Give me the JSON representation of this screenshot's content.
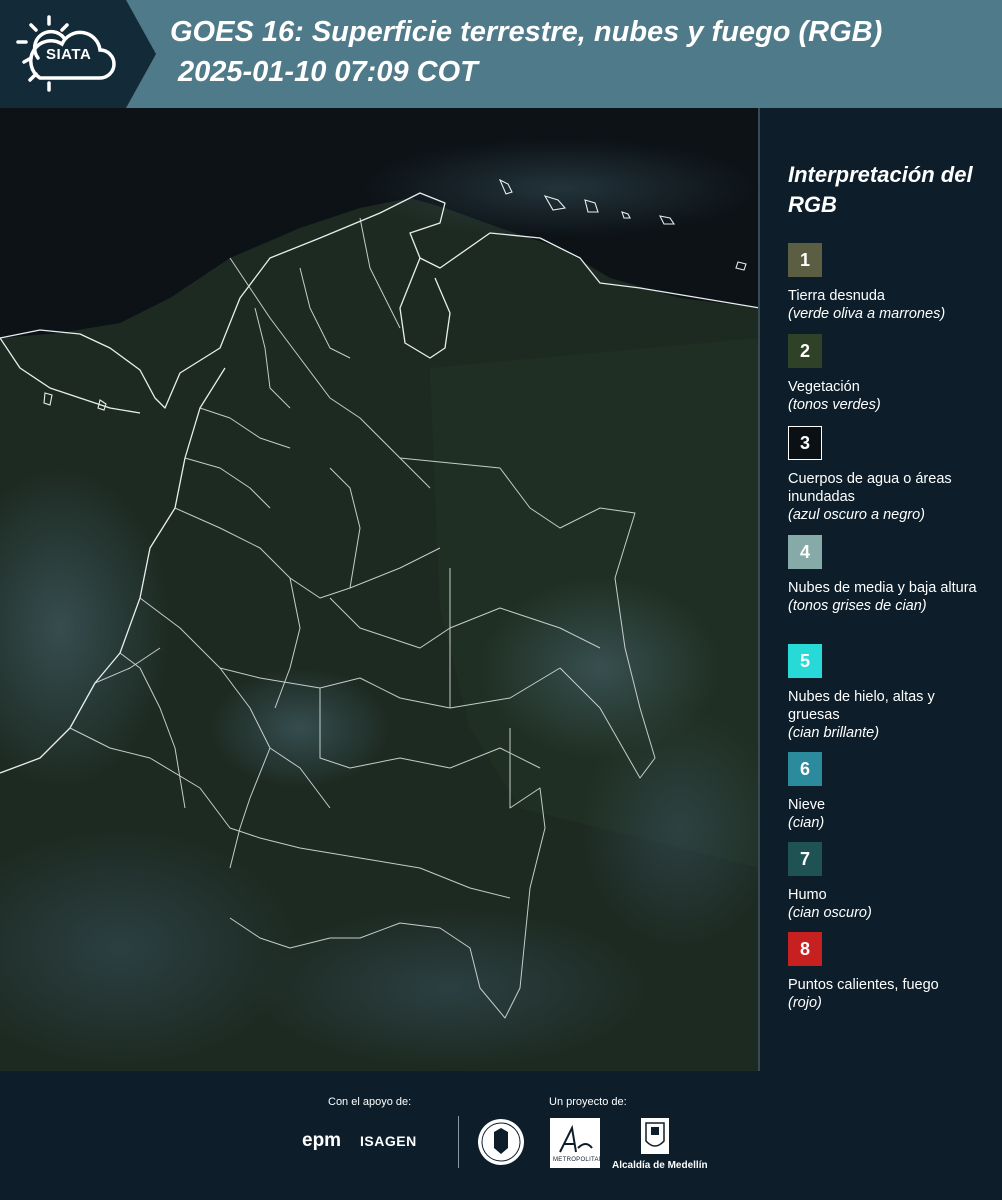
{
  "header": {
    "logo_text": "SIATA",
    "title": "GOES 16: Superficie terrestre, nubes y fuego (RGB)",
    "subtitle": "2025-01-10 07:09 COT",
    "colors": {
      "band_left": "#132a38",
      "band_right": "#4f7a89"
    }
  },
  "legend": {
    "title": "Interpretación del RGB",
    "items": [
      {
        "number": "1",
        "label": "Tierra desnuda",
        "note": "(verde oliva a marrones)",
        "color": "#5b5e42"
      },
      {
        "number": "2",
        "label": "Vegetación",
        "note": "(tonos verdes)",
        "color": "#2f4227"
      },
      {
        "number": "3",
        "label": "Cuerpos de agua o áreas inundadas",
        "note": "(azul oscuro a negro)",
        "color": "#0a1014"
      },
      {
        "number": "4",
        "label": "Nubes de media y baja altura",
        "note": "(tonos grises de cian)",
        "color": "#85aaa8"
      },
      {
        "number": "5",
        "label": "Nubes de hielo, altas y gruesas",
        "note": "(cian brillante)",
        "color": "#27d9d7"
      },
      {
        "number": "6",
        "label": "Nieve",
        "note": "(cian)",
        "color": "#2b8a9c"
      },
      {
        "number": "7",
        "label": "Humo",
        "note": "(cian oscuro)",
        "color": "#1f5353"
      },
      {
        "number": "8",
        "label": "Puntos calientes, fuego",
        "note": "(rojo)",
        "color": "#c72021"
      }
    ]
  },
  "footer": {
    "support_label": "Con el apoyo de:",
    "project_label": "Un proyecto de:",
    "sponsors": [
      "epm",
      "ISAGEN"
    ],
    "amva_text": "METROPOLITANA",
    "alcaldia": "Alcaldía de Medellín"
  }
}
